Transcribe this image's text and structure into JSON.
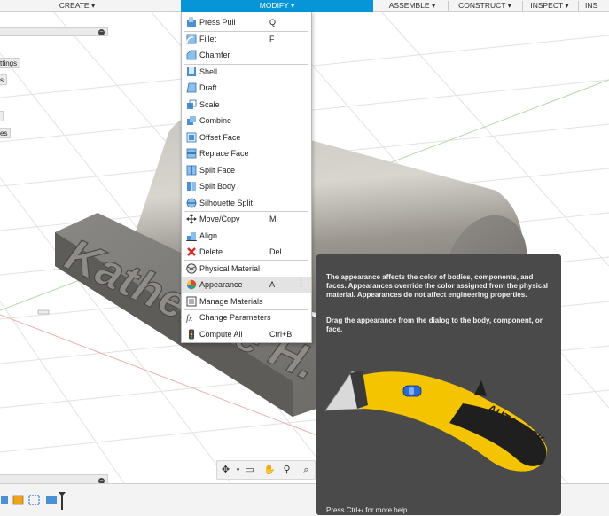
{
  "toolbar": {
    "items": [
      {
        "label": "CREATE ▾"
      },
      {
        "label": "MODIFY ▾"
      },
      {
        "label": "ASSEMBLE ▾"
      },
      {
        "label": "CONSTRUCT ▾"
      },
      {
        "label": "INSPECT ▾"
      },
      {
        "label": "INS"
      }
    ],
    "active_color": "#0696d7"
  },
  "browser": {
    "chips": [
      "ttings",
      "s",
      "es"
    ]
  },
  "model": {
    "text_label": "Katherine H."
  },
  "modify_menu": {
    "items": [
      {
        "label": "Press Pull",
        "shortcut": "Q",
        "icon": "press-pull-icon"
      },
      {
        "label": "Fillet",
        "shortcut": "F",
        "icon": "fillet-icon"
      },
      {
        "label": "Chamfer",
        "shortcut": "",
        "icon": "chamfer-icon"
      },
      {
        "label": "Shell",
        "shortcut": "",
        "icon": "shell-icon"
      },
      {
        "label": "Draft",
        "shortcut": "",
        "icon": "draft-icon"
      },
      {
        "label": "Scale",
        "shortcut": "",
        "icon": "scale-icon"
      },
      {
        "label": "Combine",
        "shortcut": "",
        "icon": "combine-icon"
      },
      {
        "label": "Offset Face",
        "shortcut": "",
        "icon": "offset-face-icon"
      },
      {
        "label": "Replace Face",
        "shortcut": "",
        "icon": "replace-face-icon"
      },
      {
        "label": "Split Face",
        "shortcut": "",
        "icon": "split-face-icon"
      },
      {
        "label": "Split Body",
        "shortcut": "",
        "icon": "split-body-icon"
      },
      {
        "label": "Silhouette Split",
        "shortcut": "",
        "icon": "silhouette-split-icon"
      },
      {
        "label": "Move/Copy",
        "shortcut": "M",
        "icon": "move-copy-icon"
      },
      {
        "label": "Align",
        "shortcut": "",
        "icon": "align-icon"
      },
      {
        "label": "Delete",
        "shortcut": "Del",
        "icon": "delete-icon"
      },
      {
        "label": "Physical Material",
        "shortcut": "",
        "icon": "physical-material-icon"
      },
      {
        "label": "Appearance",
        "shortcut": "A",
        "icon": "appearance-icon"
      },
      {
        "label": "Manage Materials",
        "shortcut": "",
        "icon": "manage-materials-icon"
      },
      {
        "label": "Change Parameters",
        "shortcut": "",
        "icon": "change-parameters-icon"
      },
      {
        "label": "Compute All",
        "shortcut": "Ctrl+B",
        "icon": "compute-all-icon"
      }
    ],
    "more_glyph": "⋮"
  },
  "tooltip": {
    "paragraph1": "The appearance affects the color of bodies, components, and faces. Appearances override the color assigned from the physical material. Appearances do not affect engineering properties.",
    "paragraph2": "Drag the appearance from the dialog to the body, component, or face.",
    "brand": "AUTODESK",
    "footer": "Press Ctrl+/ for more help."
  },
  "colors": {
    "accent": "#0696d7",
    "tooltip_bg": "#4a4a4a",
    "knife_yellow": "#f5c400",
    "delete_red": "#d62a1f"
  }
}
